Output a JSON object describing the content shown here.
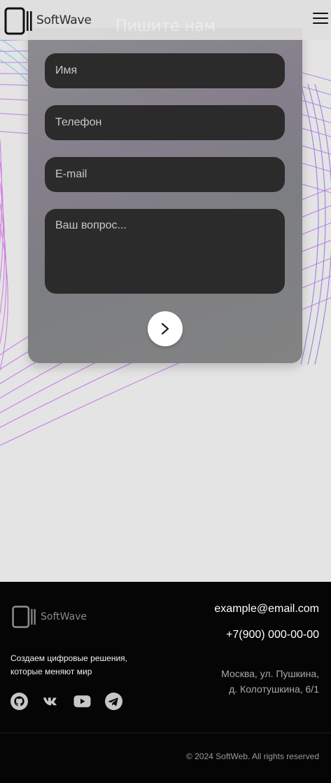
{
  "header": {
    "brand": "SoftWave",
    "ghost_title": "Пишите нам"
  },
  "form": {
    "name_placeholder": "Имя",
    "phone_placeholder": "Телефон",
    "email_placeholder": "E-mail",
    "question_placeholder": "Ваш вопрос...",
    "submit_icon": "chevron-right-icon"
  },
  "footer": {
    "brand": "SoftWave",
    "tagline_line1": "Создаем цифровые решения,",
    "tagline_line2": "которые меняют мир",
    "email": "example@email.com",
    "phone": "+7(900) 000-00-00",
    "address_line1": "Москва, ул. Пушкина,",
    "address_line2": "д. Колотушкина, 6/1",
    "copyright": "© 2024 SoftWeb. All rights reserved",
    "socials": [
      "github-icon",
      "vk-icon",
      "youtube-icon",
      "telegram-icon"
    ]
  },
  "colors": {
    "background": "#e4e4e4",
    "footer": "#050505",
    "field": "#2b2b2b",
    "accent_lines": "#b070e0"
  }
}
